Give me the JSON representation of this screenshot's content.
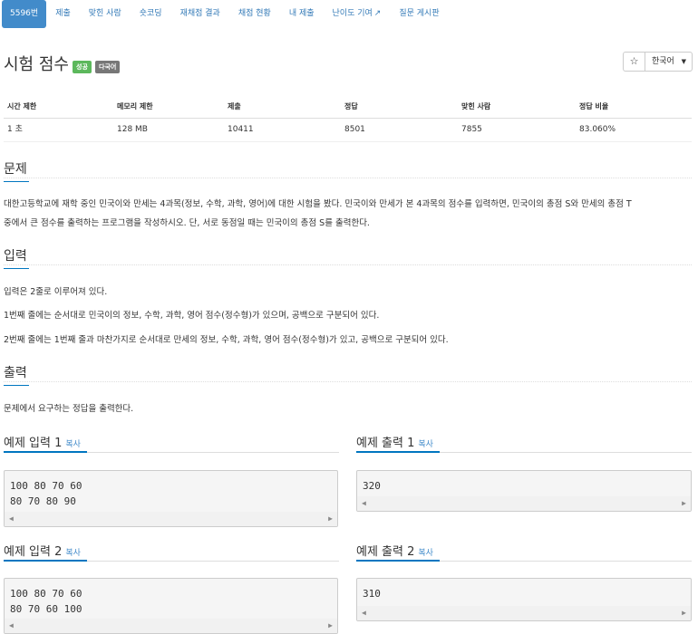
{
  "nav": {
    "tabs": [
      "5596번",
      "제출",
      "맞힌 사람",
      "숏코딩",
      "재채점 결과",
      "채점 현황",
      "내 제출",
      "난이도 기여",
      "질문 게시판"
    ]
  },
  "problem": {
    "title": "시험 점수",
    "badge_success": "성공",
    "badge_lang": "다국어",
    "star": "☆",
    "lang_select": "한국어"
  },
  "info": {
    "headers": [
      "시간 제한",
      "메모리 제한",
      "제출",
      "정답",
      "맞힌 사람",
      "정답 비율"
    ],
    "values": [
      "1 초",
      "128 MB",
      "10411",
      "8501",
      "7855",
      "83.060%"
    ]
  },
  "sections": {
    "problem_head": "문제",
    "problem_text_1": "대한고등학교에 재학 중인 민국이와 만세는 4과목(정보, 수학, 과학, 영어)에 대한 시험을 봤다. 민국이와 만세가 본 4과목의 점수를 입력하면, 민국이의 총점 S와 만세의 총점 T",
    "problem_text_2": "중에서 큰 점수를 출력하는 프로그램을 작성하시오. 단, 서로 동점일 때는 민국이의 총점 S를 출력한다.",
    "input_head": "입력",
    "input_text_1": "입력은 2줄로 이루어져 있다.",
    "input_text_2": "1번째 줄에는 순서대로 민국이의 정보, 수학, 과학, 영어 점수(정수형)가 있으며, 공백으로 구분되어 있다.",
    "input_text_3": "2번째 줄에는 1번째 줄과 마찬가지로 순서대로 만세의 정보, 수학, 과학, 영어 점수(정수형)가 있고, 공백으로 구분되어 있다.",
    "output_head": "출력",
    "output_text": "문제에서 요구하는 정답을 출력한다."
  },
  "samples": {
    "copy_label": "복사",
    "in1_title": "예제 입력 1",
    "in1": "100 80 70 60\n80 70 80 90",
    "out1_title": "예제 출력 1",
    "out1": "320",
    "in2_title": "예제 입력 2",
    "in2": "100 80 70 60\n80 70 60 100",
    "out2_title": "예제 출력 2",
    "out2": "310"
  }
}
